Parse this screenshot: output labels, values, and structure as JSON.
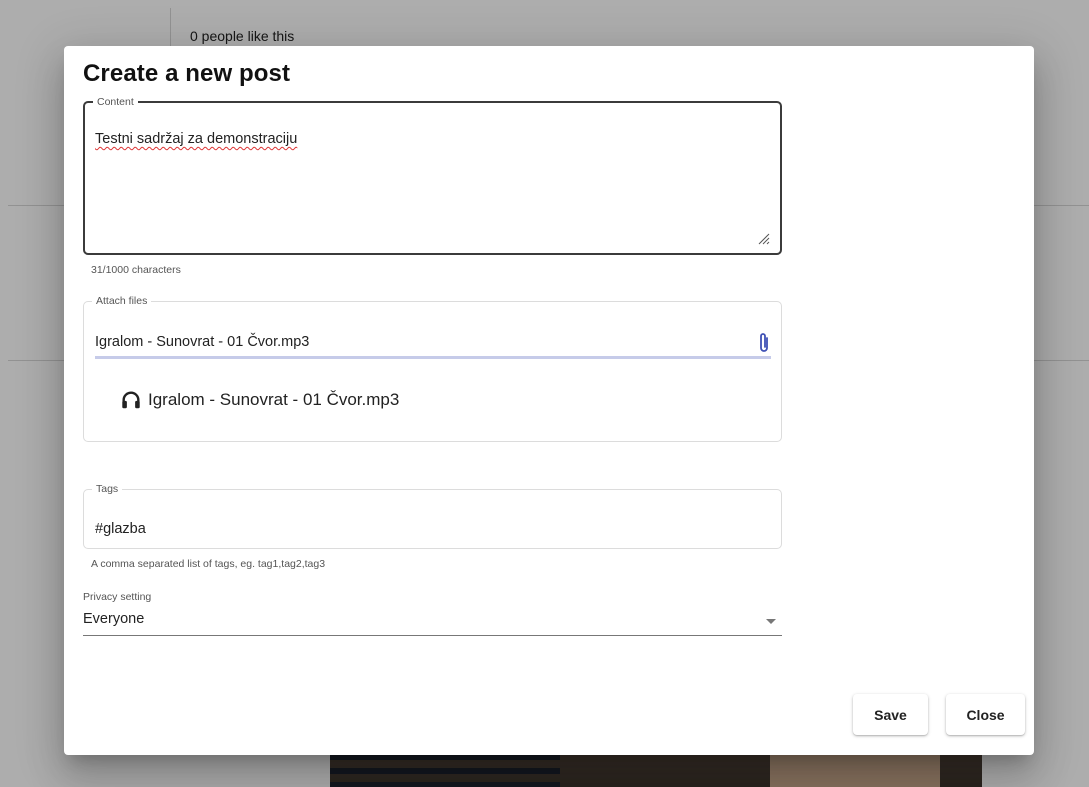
{
  "background": {
    "likes_text": "0 people like this"
  },
  "dialog": {
    "title": "Create a new post",
    "content": {
      "legend": "Content",
      "value": "Testni sadržaj za demonstraciju",
      "counter": "31/1000 characters"
    },
    "attach": {
      "legend": "Attach files",
      "value": "Igralom - Sunovrat - 01 Čvor.mp3",
      "files": [
        {
          "name": "Igralom - Sunovrat - 01 Čvor.mp3",
          "icon": "headphones-icon"
        }
      ]
    },
    "tags": {
      "legend": "Tags",
      "value": "#glazba",
      "hint": "A comma separated list of tags, eg. tag1,tag2,tag3"
    },
    "privacy": {
      "label": "Privacy setting",
      "selected": "Everyone"
    },
    "buttons": {
      "save": "Save",
      "close": "Close"
    }
  },
  "colors": {
    "attach_underline": "#c6cbe9",
    "overlay": "rgba(0,0,0,0.32)",
    "spellcheck": "#d33"
  }
}
